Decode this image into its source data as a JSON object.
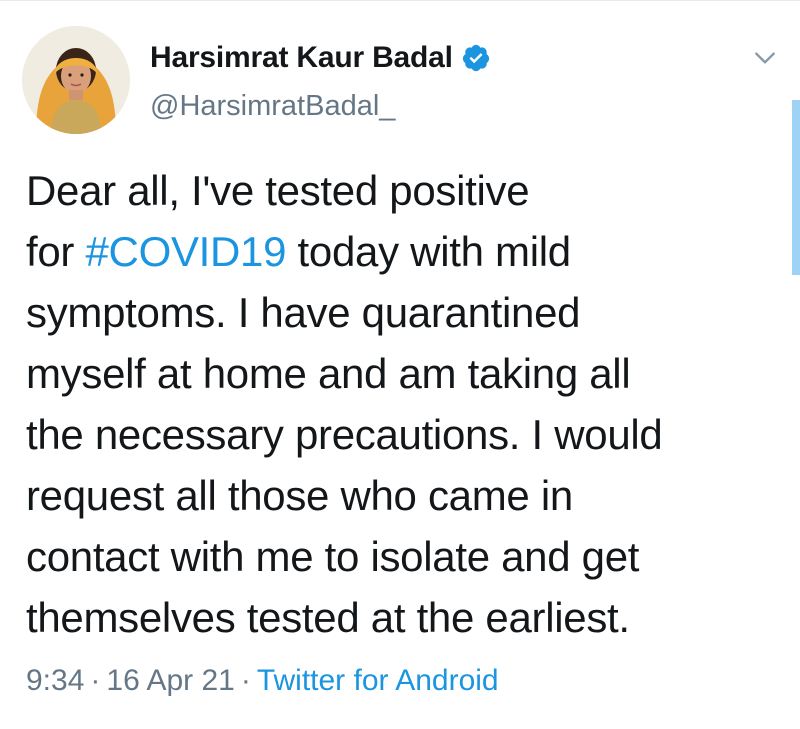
{
  "author": {
    "display_name": "Harsimrat Kaur Badal",
    "handle": "@HarsimratBadal_",
    "verified": true
  },
  "icons": {
    "verified": "verified-badge-icon",
    "menu": "chevron-down-icon"
  },
  "tweet": {
    "lines": [
      {
        "pre": "Dear all, I've tested positive",
        "tag": "",
        "post": ""
      },
      {
        "pre": "for ",
        "tag": "#COVID19",
        "post": " today with mild"
      },
      {
        "pre": "symptoms. I have quarantined",
        "tag": "",
        "post": ""
      },
      {
        "pre": "myself at home and am taking all",
        "tag": "",
        "post": ""
      },
      {
        "pre": "the necessary precautions. I would",
        "tag": "",
        "post": ""
      },
      {
        "pre": "request all those who came in",
        "tag": "",
        "post": ""
      },
      {
        "pre": "contact with me to isolate and get",
        "tag": "",
        "post": ""
      },
      {
        "pre": "themselves tested at the earliest.",
        "tag": "",
        "post": ""
      }
    ]
  },
  "meta": {
    "time": "9:34",
    "date": "16 Apr 21",
    "separator": "·",
    "source": "Twitter for Android"
  },
  "colors": {
    "link": "#1b95e0",
    "text": "#14171a",
    "secondary": "#657786"
  }
}
